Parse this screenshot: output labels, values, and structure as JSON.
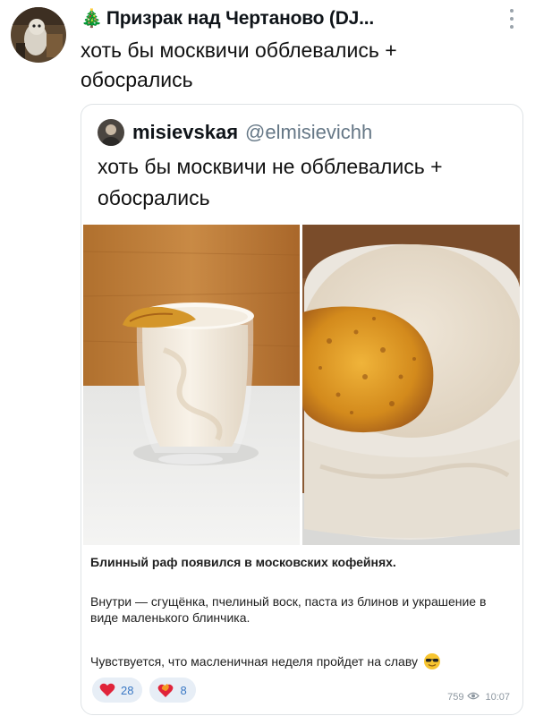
{
  "post": {
    "author": "Призрак над Чертаново (DJ...",
    "author_emoji": "🎄",
    "text": "хоть бы москвичи обблевались + обосрались"
  },
  "quote": {
    "name": "misievskaя",
    "handle": "@elmisievichh",
    "text": "хоть бы москвичи не обблевались + обосрались"
  },
  "caption": {
    "title": "Блинный раф появился в московских кофейнях.",
    "paragraph2": "Внутри — сгущёнка, пчелиный воск, паста из блинов и украшение в виде маленького блинчика.",
    "paragraph3": "Чувствуется, что масленичная неделя пройдет на славу"
  },
  "reactions": [
    {
      "icon": "heart-icon",
      "count": "28"
    },
    {
      "icon": "heart-on-fire-icon",
      "count": "8"
    }
  ],
  "meta": {
    "views": "759",
    "time": "10:07"
  },
  "colors": {
    "reaction_bg": "#e7eef6",
    "reaction_count": "#3a78c4",
    "heart": "#e0243a",
    "handle": "#657786"
  }
}
